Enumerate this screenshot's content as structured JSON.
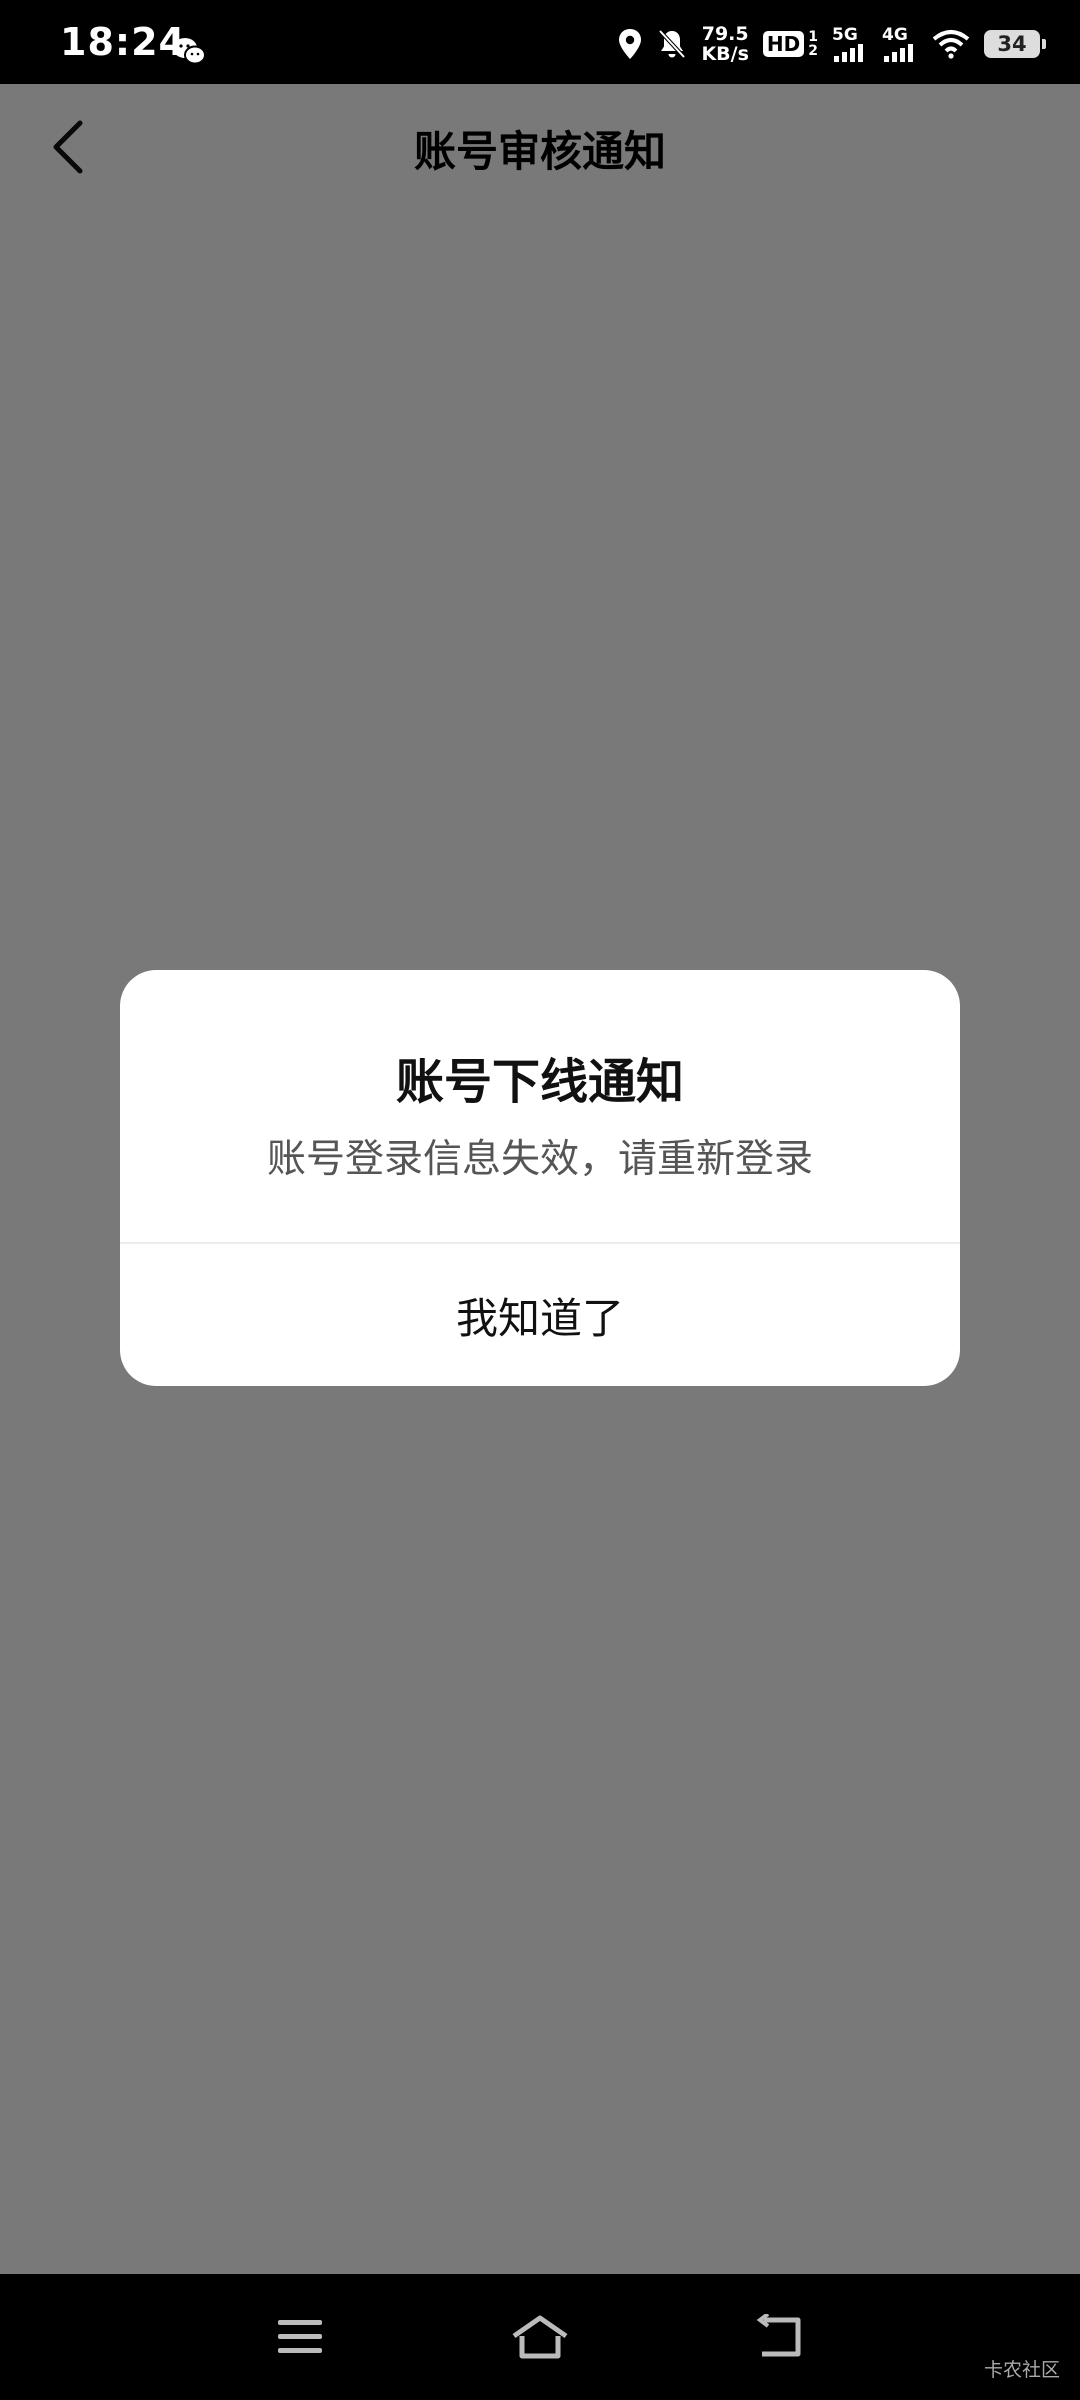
{
  "status_bar": {
    "time": "18:24",
    "net_speed_value": "79.5",
    "net_speed_unit": "KB/s",
    "hd_label": "HD",
    "hd_sub_top": "1",
    "hd_sub_bottom": "2",
    "sim1_label": "5G",
    "sim2_label": "4G",
    "battery": "34",
    "icons": [
      "wechat-icon",
      "location-icon",
      "bell-muted-icon",
      "signal-icon",
      "wifi-icon",
      "battery-icon"
    ]
  },
  "header": {
    "title": "账号审核通知",
    "back_icon": "chevron-left-icon"
  },
  "dialog": {
    "title": "账号下线通知",
    "message": "账号登录信息失效，请重新登录",
    "button_label": "我知道了"
  },
  "nav_bar": {
    "icons": [
      "menu-icon",
      "home-icon",
      "back-icon"
    ]
  },
  "watermark": "卡农社区"
}
